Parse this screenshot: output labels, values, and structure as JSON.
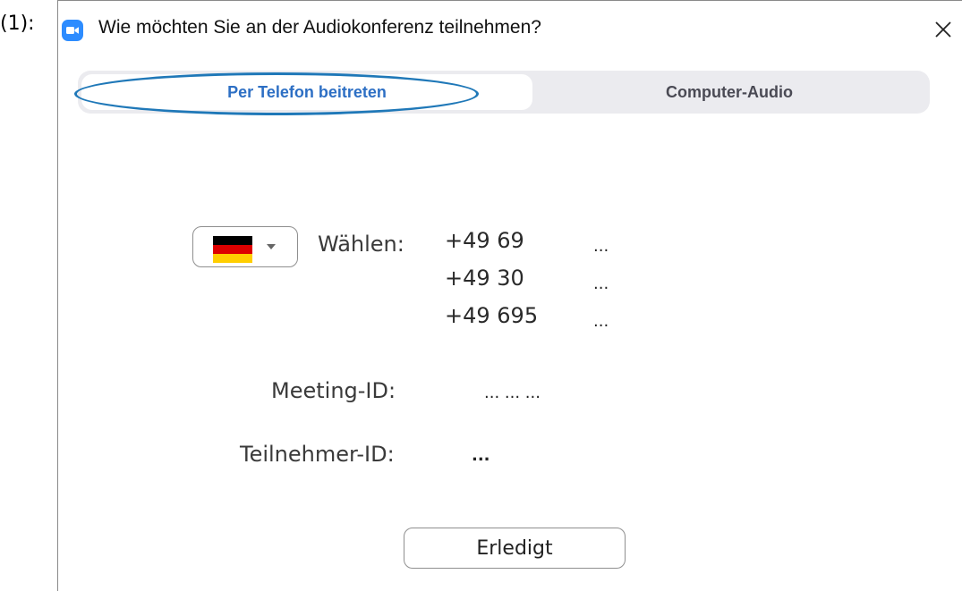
{
  "step_label": "(1):",
  "window": {
    "title": "Wie möchten Sie an der Audiokonferenz teilnehmen?",
    "app_icon": "zoom-icon",
    "close_icon": "close-icon"
  },
  "tabs": [
    {
      "label": "Per Telefon beitreten",
      "selected": true
    },
    {
      "label": "Computer-Audio",
      "selected": false
    }
  ],
  "colors": {
    "selected_tab_text": "#2d6fc4",
    "highlight_outline": "#1f78b8",
    "zoom_brand": "#2d8cff"
  },
  "dial": {
    "country": "Deutschland",
    "flag_colors": [
      "#000000",
      "#dd0000",
      "#ffce00"
    ],
    "label": "Wählen:",
    "numbers": [
      {
        "number": "+49 69",
        "rest": "..."
      },
      {
        "number": "+49 30",
        "rest": "..."
      },
      {
        "number": "+49 695",
        "rest": "..."
      }
    ]
  },
  "meeting": {
    "label": "Meeting-ID:",
    "value": "... ... ..."
  },
  "participant": {
    "label": "Teilnehmer-ID:",
    "value": "..."
  },
  "done_button": {
    "label": "Erledigt"
  }
}
